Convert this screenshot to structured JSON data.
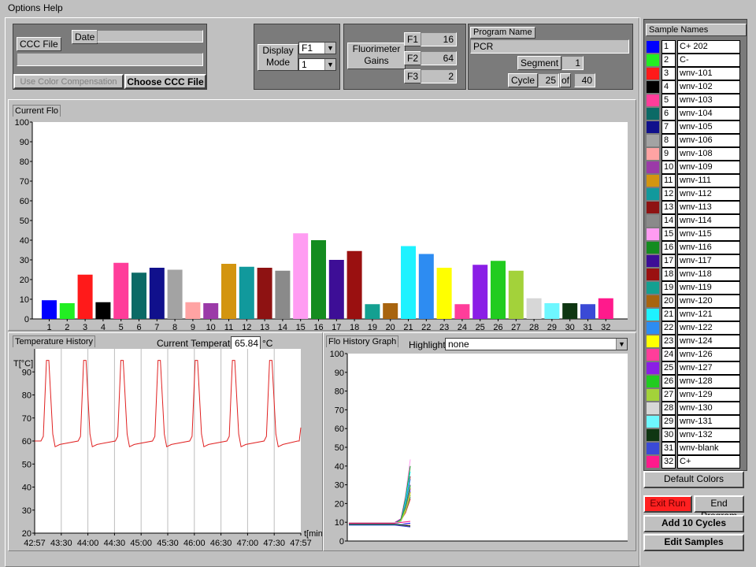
{
  "menu": {
    "options": "Options",
    "help": "Help"
  },
  "ccc": {
    "ccc_file_label": "CCC File",
    "date_label": "Date",
    "date_value": "",
    "file_value": "",
    "use_color_comp": "Use Color Compensation",
    "choose_ccc": "Choose CCC File"
  },
  "display": {
    "mode_label_1": "Display",
    "mode_label_2": "Mode",
    "channel": "F1",
    "mode_value": "1"
  },
  "gains": {
    "label_1": "Fluorimeter",
    "label_2": "Gains",
    "f1_label": "F1",
    "f1_value": "16",
    "f2_label": "F2",
    "f2_value": "64",
    "f3_label": "F3",
    "f3_value": "2"
  },
  "program": {
    "name_label": "Program Name",
    "name_value": "PCR",
    "segment_label": "Segment",
    "segment_value": "1",
    "cycle_label": "Cycle",
    "cycle_value": "25",
    "of_label": "of",
    "cycle_total": "40"
  },
  "current_flo": {
    "title": "Current Flo"
  },
  "temperature": {
    "title": "Temperature History",
    "current_label": "Current Temperature",
    "current_value": "65.84",
    "unit": "°C",
    "ylabel": "T[°C]",
    "xlabel": "t[min]"
  },
  "flo_history": {
    "title": "Flo History Graph",
    "highlight_label": "Highlight:",
    "highlight_value": "none"
  },
  "sample_names": {
    "title": "Sample Names",
    "items": [
      {
        "num": "1",
        "name": "C+ 202",
        "color": "#0000ff"
      },
      {
        "num": "2",
        "name": "C-",
        "color": "#22ee22"
      },
      {
        "num": "3",
        "name": "wnv-101",
        "color": "#ff1a1a"
      },
      {
        "num": "4",
        "name": "wnv-102",
        "color": "#000000"
      },
      {
        "num": "5",
        "name": "wnv-103",
        "color": "#ff3d9a"
      },
      {
        "num": "6",
        "name": "wnv-104",
        "color": "#0b6a66"
      },
      {
        "num": "7",
        "name": "wnv-105",
        "color": "#10108c"
      },
      {
        "num": "8",
        "name": "wnv-106",
        "color": "#a3a3a3"
      },
      {
        "num": "9",
        "name": "wnv-108",
        "color": "#ffa3a3"
      },
      {
        "num": "10",
        "name": "wnv-109",
        "color": "#9b3aa8"
      },
      {
        "num": "11",
        "name": "wnv-111",
        "color": "#d39510"
      },
      {
        "num": "12",
        "name": "wnv-112",
        "color": "#11999c"
      },
      {
        "num": "13",
        "name": "wnv-113",
        "color": "#8e1212"
      },
      {
        "num": "14",
        "name": "wnv-114",
        "color": "#8a8a8a"
      },
      {
        "num": "15",
        "name": "wnv-115",
        "color": "#ff9cf2"
      },
      {
        "num": "16",
        "name": "wnv-116",
        "color": "#148c1f"
      },
      {
        "num": "17",
        "name": "wnv-117",
        "color": "#3d0e96"
      },
      {
        "num": "18",
        "name": "wnv-118",
        "color": "#9a1010"
      },
      {
        "num": "19",
        "name": "wnv-119",
        "color": "#14a091"
      },
      {
        "num": "20",
        "name": "wnv-120",
        "color": "#a8640f"
      },
      {
        "num": "21",
        "name": "wnv-121",
        "color": "#1ef2ff"
      },
      {
        "num": "22",
        "name": "wnv-122",
        "color": "#2d8cf2"
      },
      {
        "num": "23",
        "name": "wnv-124",
        "color": "#ffff00"
      },
      {
        "num": "24",
        "name": "wnv-126",
        "color": "#ff3d9a"
      },
      {
        "num": "25",
        "name": "wnv-127",
        "color": "#8a1ee6"
      },
      {
        "num": "26",
        "name": "wnv-128",
        "color": "#21cc1f"
      },
      {
        "num": "27",
        "name": "wnv-129",
        "color": "#a3d23a"
      },
      {
        "num": "28",
        "name": "wnv-130",
        "color": "#d7d7d7"
      },
      {
        "num": "29",
        "name": "wnv-131",
        "color": "#6ef7ff"
      },
      {
        "num": "30",
        "name": "wnv-132",
        "color": "#0f3612"
      },
      {
        "num": "31",
        "name": "wnv-blank",
        "color": "#3a4ad6"
      },
      {
        "num": "32",
        "name": "C+",
        "color": "#ff1a8c"
      }
    ]
  },
  "buttons": {
    "default_colors": "Default Colors",
    "exit_run": "Exit Run",
    "end_program": "End Program",
    "add_cycles": "Add 10 Cycles",
    "edit_samples": "Edit Samples"
  },
  "chart_data": [
    {
      "type": "bar",
      "categories": [
        "1",
        "2",
        "3",
        "4",
        "5",
        "6",
        "7",
        "8",
        "9",
        "10",
        "11",
        "12",
        "13",
        "14",
        "15",
        "16",
        "17",
        "18",
        "19",
        "20",
        "21",
        "22",
        "23",
        "24",
        "25",
        "26",
        "27",
        "28",
        "29",
        "30",
        "31",
        "32"
      ],
      "values": [
        9.5,
        8,
        22.5,
        8.5,
        28.5,
        23.5,
        26,
        25,
        8.5,
        8,
        28,
        26.5,
        26,
        24.5,
        43.5,
        40,
        30,
        34.5,
        7.5,
        8,
        37,
        33,
        26,
        7.5,
        27.5,
        29.5,
        24.5,
        10.5,
        8,
        8,
        7.5,
        10.5
      ],
      "ylim": [
        0,
        100
      ],
      "yticks": [
        "0",
        "10",
        "20",
        "30",
        "40",
        "50",
        "60",
        "70",
        "80",
        "90",
        "100"
      ]
    },
    {
      "type": "line",
      "x_ticks": [
        "42:57",
        "43:30",
        "44:00",
        "44:30",
        "45:00",
        "45:30",
        "46:00",
        "46:30",
        "47:00",
        "47:30",
        "47:57"
      ],
      "y_ticks": [
        "20",
        "30",
        "40",
        "50",
        "60",
        "70",
        "80",
        "90"
      ],
      "ylim": [
        20,
        100
      ],
      "series_color": "#e02020",
      "cycle_peaks": [
        95,
        95,
        95,
        95,
        95,
        95,
        95
      ],
      "baseline": 60,
      "trough": 57.5,
      "final": 65.84
    },
    {
      "type": "line",
      "y_ticks": [
        "0",
        "10",
        "20",
        "30",
        "40",
        "50",
        "60",
        "70",
        "80",
        "90",
        "100"
      ],
      "ylim": [
        0,
        100
      ],
      "cycles_shown": 25,
      "baseline": 9,
      "final_values": [
        9.5,
        8,
        22.5,
        8.5,
        28.5,
        23.5,
        26,
        25,
        8.5,
        8,
        28,
        26.5,
        26,
        24.5,
        43.5,
        40,
        30,
        34.5,
        7.5,
        8,
        37,
        33,
        26,
        7.5,
        27.5,
        29.5,
        24.5,
        10.5,
        8,
        8,
        7.5,
        10.5
      ]
    }
  ]
}
